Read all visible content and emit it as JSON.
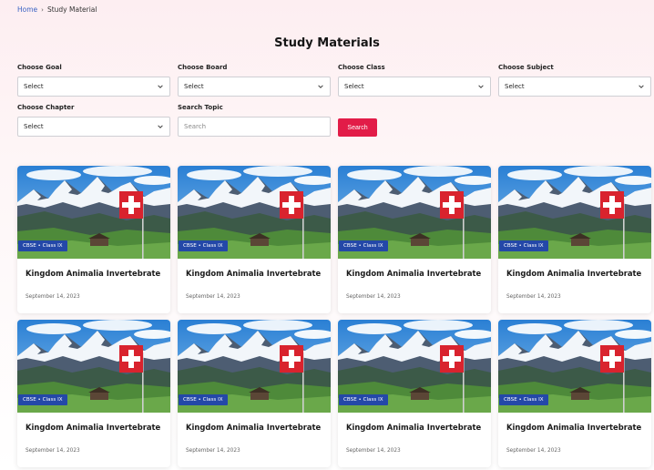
{
  "breadcrumb": {
    "home": "Home",
    "separator": "›",
    "current": "Study Material"
  },
  "page": {
    "title": "Study Materials"
  },
  "filters": {
    "goal": {
      "label": "Choose Goal",
      "value": "Select"
    },
    "board": {
      "label": "Choose Board",
      "value": "Select"
    },
    "class": {
      "label": "Choose Class",
      "value": "Select"
    },
    "subject": {
      "label": "Choose Subject",
      "value": "Select"
    },
    "chapter": {
      "label": "Choose Chapter",
      "value": "Select"
    },
    "topic": {
      "label": "Search Topic",
      "placeholder": "Search"
    },
    "search_button": "Search"
  },
  "colors": {
    "accent": "#e21c48",
    "badge": "#2448a8",
    "link": "#3b63c4"
  },
  "cards": [
    {
      "badge": "CBSE • Class IX",
      "title": "Kingdom Animalia Invertebrate",
      "date": "September 14, 2023"
    },
    {
      "badge": "CBSE • Class IX",
      "title": "Kingdom Animalia Invertebrate",
      "date": "September 14, 2023"
    },
    {
      "badge": "CBSE • Class IX",
      "title": "Kingdom Animalia Invertebrate",
      "date": "September 14, 2023"
    },
    {
      "badge": "CBSE • Class IX",
      "title": "Kingdom Animalia Invertebrate",
      "date": "September 14, 2023"
    },
    {
      "badge": "CBSE • Class IX",
      "title": "Kingdom Animalia Invertebrate",
      "date": "September 14, 2023"
    },
    {
      "badge": "CBSE • Class IX",
      "title": "Kingdom Animalia Invertebrate",
      "date": "September 14, 2023"
    },
    {
      "badge": "CBSE • Class IX",
      "title": "Kingdom Animalia Invertebrate",
      "date": "September 14, 2023"
    },
    {
      "badge": "CBSE • Class IX",
      "title": "Kingdom Animalia Invertebrate",
      "date": "September 14, 2023"
    }
  ]
}
